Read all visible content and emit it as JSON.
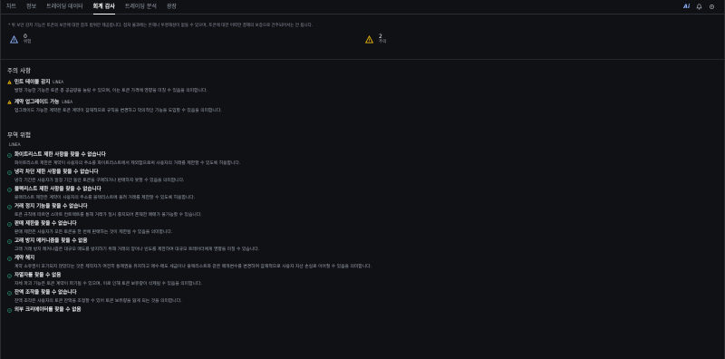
{
  "tabs": [
    {
      "label": "차트",
      "active": false
    },
    {
      "label": "정보",
      "active": false
    },
    {
      "label": "트레이딩 데이터",
      "active": false
    },
    {
      "label": "회계 감사",
      "active": true
    },
    {
      "label": "트레이딩 분석",
      "active": false
    },
    {
      "label": "광장",
      "active": false
    }
  ],
  "top_right": {
    "ai_label": "Ai",
    "icons": [
      "bell-icon",
      "settings-icon"
    ]
  },
  "notice": "* 위 보안 감지 기능은 토큰의 보안에 대한 참조 범위만 제공합니다. 점처 불과에는 돈해나 투명해성이 없을 수 있으며, 토큰에 대한 어떠한 결해의 보증으로 간주되어서는 안 됩니다.",
  "counts": [
    {
      "value": "0",
      "label": "위험",
      "color": "#8fb4ff"
    },
    {
      "value": "2",
      "label": "주의",
      "color": "#f0b90b"
    }
  ],
  "caution": {
    "title": "주의 사항",
    "items": [
      {
        "title": "민트 테이블 감지",
        "badge": "LINEA",
        "desc": "발행 가능한 기능은 토큰 총 공급량을 늘릴 수 있으며, 이는 토큰 가격에 영향을 미칠 수 있음을 의미합니다."
      },
      {
        "title": "계약 업그레이드 가능",
        "badge": "LINEA",
        "desc": "업그레이드 가능한 계약은 토큰 계약이 잠재적으로 규칙을 변경하고 악의적인 기능을 도입할 수 있음을 의미합니다."
      }
    ]
  },
  "nonrisk": {
    "title": "무역 위험",
    "chain": "LINEA",
    "items": [
      {
        "title": "화이트리스트 제한 사항을 찾을 수 없습니다",
        "desc": "화이트리스트 제한은 계약이 사용자의 주소를 화이트리스트에서 제외함으로써 사용자의 거래를 제한할 수 있도록 허용합니다."
      },
      {
        "title": "냉각 차단 제한 사항을 찾을 수 없습니다",
        "desc": "냉각 기간은 사용자가 일정 기간 동안 토큰을 구매하거나 판매하지 못할 수 있음을 의미합니다."
      },
      {
        "title": "블랙리스트 제한 사항을 찾을 수 없습니다",
        "desc": "블랙리스트 제한은 계약이 사용자의 주소를 블랙리스트에 올려 거래를 제한할 수 있도록 허용합니다."
      },
      {
        "title": "거래 정지 기능을 찾을 수 없습니다",
        "desc": "토큰 규칙에 따르면 스마트 컨트랙트를 통해 거래가 일시 중지되어 존재한 매매가 불가능할 수 있습니다."
      },
      {
        "title": "판매 제한을 찾을 수 없습니다",
        "desc": "판매 제한은 사용자가 모든 토큰을 한 번에 판매하는 것이 제한될 수 있음을 의미합니다."
      },
      {
        "title": "고래 방지 메커니즘을 찾을 수 없음",
        "desc": "고래 거래 방지 메커니즘은 대규모 매도를 방지하기 위해 거래의 양이나 빈도를 제한하여 대규모 트레이더에게 영향을 미칠 수 있습니다."
      },
      {
        "title": "계약 해지",
        "desc": "계약 소유권이 포기되지 않았다는 것은 제작자가 여전히 통제권을 유지하고 매수·매도 세금이나 블랙리스트와 같은 매개변수를 변경하여 잠재적으로 사용자 자산 손실로 이어질 수 있음을 의미합니다."
      },
      {
        "title": "자멸자를 찾을 수 없음",
        "desc": "자체 파괴 기능은 토큰 계약이 파기될 수 있으며, 이로 인해 토큰 보유량이 삭제될 수 있음을 의미합니다."
      },
      {
        "title": "잔액 조작을 찾을 수 없습니다",
        "desc": "잔액 조작은 사용자의 토큰 잔액을 조정할 수 있어 토큰 보유량을 잃게 되는 것을 의미합니다."
      },
      {
        "title": "외부 크리에이터를 찾을 수 없음",
        "desc": ""
      }
    ]
  }
}
